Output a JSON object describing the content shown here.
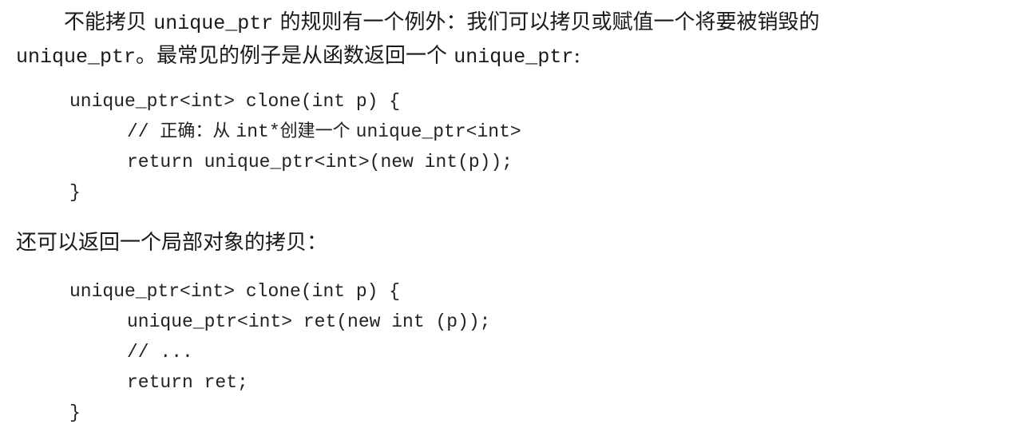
{
  "paragraph_1": {
    "line_1_pre": "不能拷贝 ",
    "line_1_code": "unique_ptr",
    "line_1_post": " 的规则有一个例外：我们可以拷贝或赋值一个将要被销毁的",
    "line_2_code": "unique_ptr",
    "line_2_mid": "。最常见的例子是从函数返回一个 ",
    "line_2_code_2": "unique_ptr",
    "line_2_end": ":"
  },
  "code_1": {
    "line_1": "unique_ptr<int> clone(int p) {",
    "line_2_comment_prefix": "// ",
    "line_2_comment_cjk_1": "正确：从 ",
    "line_2_comment_code": "int*",
    "line_2_comment_cjk_2": "创建一个 ",
    "line_2_comment_code_2": "unique_ptr<int>",
    "line_3": "return unique_ptr<int>(new int(p));",
    "line_4": "}"
  },
  "paragraph_2": {
    "text": "还可以返回一个局部对象的拷贝："
  },
  "code_2": {
    "line_1": "unique_ptr<int> clone(int p) {",
    "line_2": "unique_ptr<int> ret(new int (p));",
    "line_3": "// ...",
    "line_4": "return ret;",
    "line_5": "}"
  }
}
